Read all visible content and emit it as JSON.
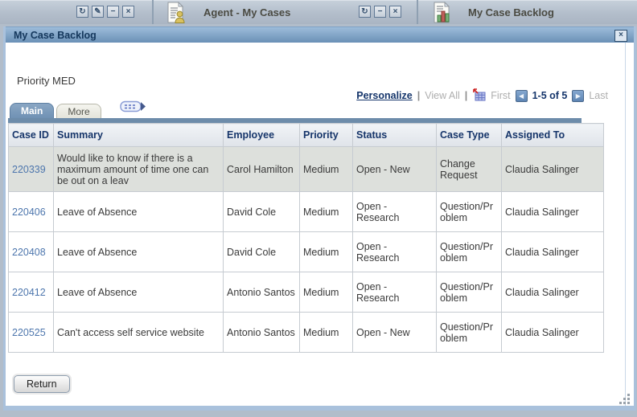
{
  "icons": {
    "refresh": "↻",
    "edit": "✎",
    "minimize": "−",
    "close": "×",
    "dialog_close": "×",
    "prev": "◀",
    "next": "▶"
  },
  "top_bar": {
    "my_cases_title": "Agent - My Cases",
    "backlog_title": "My Case Backlog"
  },
  "dialog": {
    "title": "My Case Backlog",
    "priority_label": "Priority MED",
    "toolbar": {
      "personalize": "Personalize",
      "separator": "|",
      "view_all": "View All",
      "first": "First",
      "range": "1-5 of 5",
      "last": "Last"
    },
    "tabs": [
      {
        "label": "Main"
      },
      {
        "label": "More"
      }
    ],
    "grid": {
      "columns": [
        "Case ID",
        "Summary",
        "Employee",
        "Priority",
        "Status",
        "Case Type",
        "Assigned To"
      ],
      "rows": [
        {
          "case_id": "220339",
          "summary": "Would like to know if there is a maximum amount of time one can be out on a leav",
          "employee": "Carol Hamilton",
          "priority": "Medium",
          "status": "Open - New",
          "case_type": "Change Request",
          "assigned_to": "Claudia Salinger"
        },
        {
          "case_id": "220406",
          "summary": "Leave of Absence",
          "employee": "David Cole",
          "priority": "Medium",
          "status": "Open - Research",
          "case_type": "Question/Problem",
          "assigned_to": "Claudia Salinger"
        },
        {
          "case_id": "220408",
          "summary": "Leave of Absence",
          "employee": "David Cole",
          "priority": "Medium",
          "status": "Open - Research",
          "case_type": "Question/Problem",
          "assigned_to": "Claudia Salinger"
        },
        {
          "case_id": "220412",
          "summary": "Leave of Absence",
          "employee": "Antonio Santos",
          "priority": "Medium",
          "status": "Open - Research",
          "case_type": "Question/Problem",
          "assigned_to": "Claudia Salinger"
        },
        {
          "case_id": "220525",
          "summary": "Can't access self service website",
          "employee": "Antonio Santos",
          "priority": "Medium",
          "status": "Open - New",
          "case_type": "Question/Problem",
          "assigned_to": "Claudia Salinger"
        }
      ]
    },
    "return_button": "Return"
  },
  "colors": {
    "titlebar_accent": "#6e93b8",
    "page_background": "#b2bdca",
    "link": "#15356b",
    "case_link": "#4d76ad",
    "row_highlight": "#dde0dc",
    "grid_bar": "#6d8caa",
    "modal_border": "#a9c1dc"
  }
}
